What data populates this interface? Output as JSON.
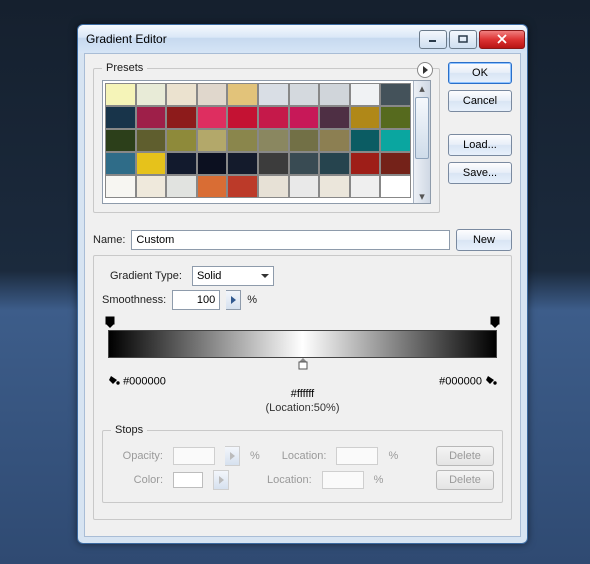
{
  "window": {
    "title": "Gradient Editor"
  },
  "buttons": {
    "ok": "OK",
    "cancel": "Cancel",
    "load": "Load...",
    "save": "Save...",
    "new": "New",
    "delete": "Delete"
  },
  "presets": {
    "legend": "Presets"
  },
  "name": {
    "label": "Name:",
    "value": "Custom"
  },
  "gradient": {
    "type_label": "Gradient Type:",
    "type_value": "Solid",
    "smoothness_label": "Smoothness:",
    "smoothness_value": "100",
    "smoothness_unit": "%",
    "left_hex": "#000000",
    "right_hex": "#000000",
    "mid_hex": "#ffffff",
    "mid_location": "(Location:50%)"
  },
  "stops": {
    "legend": "Stops",
    "opacity_label": "Opacity:",
    "location_label": "Location:",
    "percent": "%",
    "color_label": "Color:"
  },
  "swatches": [
    "#f5f4b8",
    "#e8ebd7",
    "#ebe2cf",
    "#e0d7cc",
    "#e2c37a",
    "#d9dee5",
    "#d4d9de",
    "#d0d5da",
    "#f0f2f4",
    "#44525a",
    "#18344a",
    "#9e1f49",
    "#8d1b1b",
    "#de2e60",
    "#c41233",
    "#c5194a",
    "#c71858",
    "#4e2f44",
    "#b08818",
    "#566a1e",
    "#2c3f1a",
    "#5f5e2e",
    "#8e8a3a",
    "#b3a86a",
    "#8a864c",
    "#8a8760",
    "#727046",
    "#8c7f52",
    "#0b5c63",
    "#0aa6a0",
    "#2f6c88",
    "#e6c21b",
    "#121a2d",
    "#0c1020",
    "#141b2c",
    "#3c3c3c",
    "#394b53",
    "#26444e",
    "#9e1e18",
    "#742219",
    "#f7f6f2",
    "#efe9dc",
    "#e1e3e0",
    "#d96d34",
    "#bc3a29",
    "#e7e1d6",
    "#e9e9e9",
    "#ebe6db",
    "#efefef",
    "#ffffff"
  ]
}
